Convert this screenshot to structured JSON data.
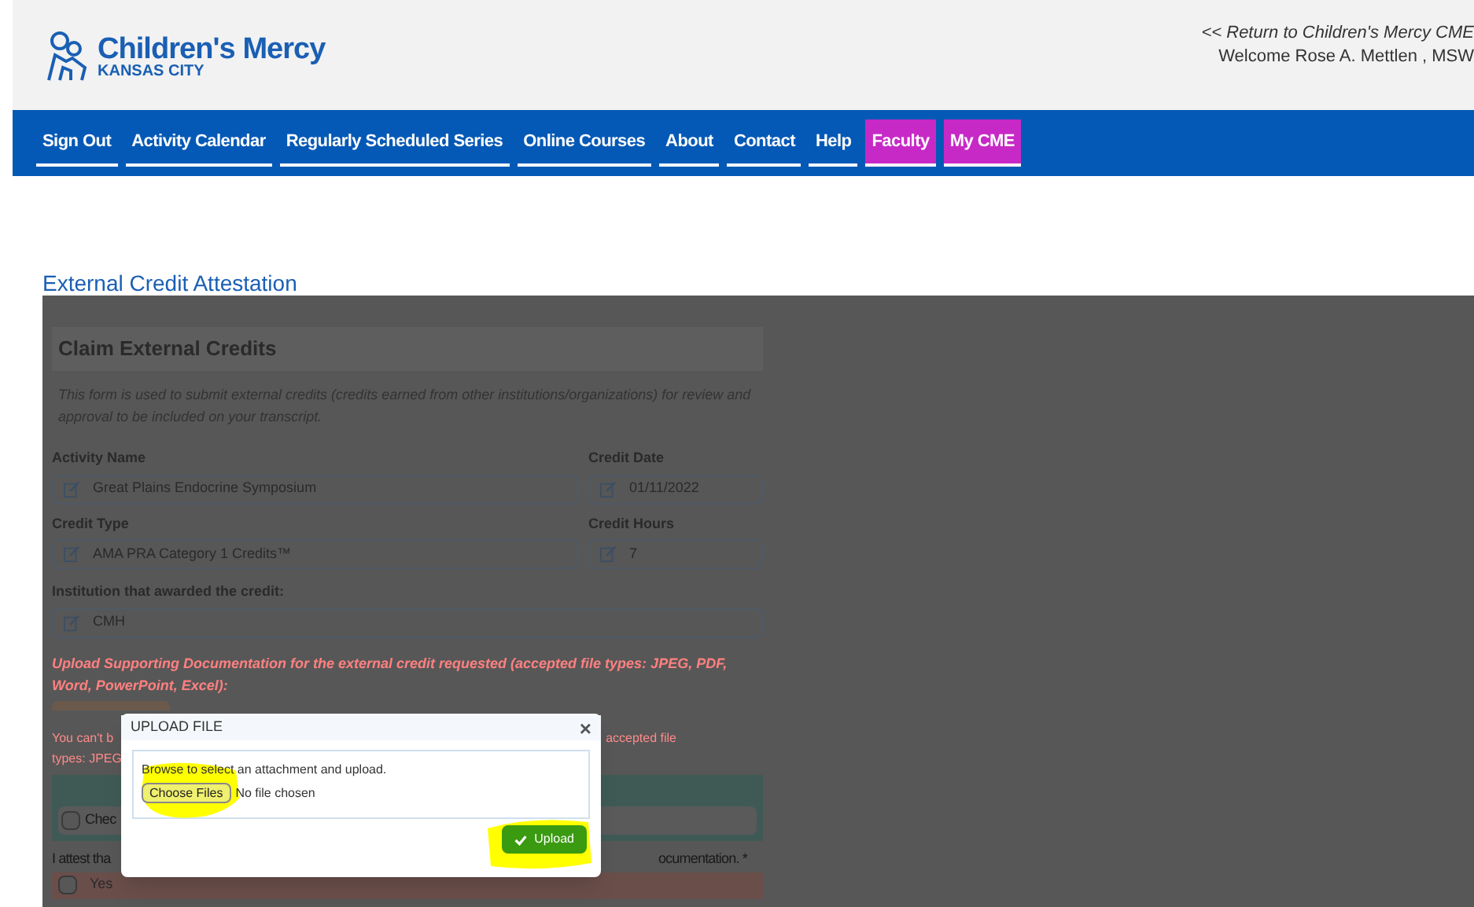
{
  "header": {
    "logo_name": "Children's Mercy",
    "logo_sub": "KANSAS CITY",
    "return_link": "<< Return to Children's Mercy CME",
    "welcome": "Welcome Rose A. Mettlen , MSW"
  },
  "nav": [
    {
      "label": "Sign Out",
      "highlighted": false
    },
    {
      "label": "Activity Calendar",
      "highlighted": false
    },
    {
      "label": "Regularly Scheduled Series",
      "highlighted": false
    },
    {
      "label": "Online Courses",
      "highlighted": false
    },
    {
      "label": "About",
      "highlighted": false
    },
    {
      "label": "Contact",
      "highlighted": false
    },
    {
      "label": "Help",
      "highlighted": false
    },
    {
      "label": "Faculty",
      "highlighted": true
    },
    {
      "label": "My CME",
      "highlighted": true
    }
  ],
  "page_title": "External Credit Attestation",
  "form": {
    "title": "Claim External Credits",
    "description": "This form is used to submit external credits (credits earned from other institutions/organizations) for review and approval to be included on your transcript.",
    "activity_name": {
      "label": "Activity Name",
      "value": "Great Plains Endocrine Symposium"
    },
    "credit_date": {
      "label": "Credit Date",
      "value": "01/11/2022"
    },
    "credit_type": {
      "label": "Credit Type",
      "value": "AMA PRA Category 1 Credits™"
    },
    "credit_hours": {
      "label": "Credit Hours",
      "value": "7"
    },
    "institution": {
      "label": "Institution that awarded the credit:",
      "value": "CMH"
    },
    "upload_note": "Upload Supporting Documentation for the external credit requested (accepted file types: JPEG, PDF, Word, PowerPoint, Excel):",
    "warning_left": [
      "You can't b",
      "types: JPEG"
    ],
    "warning_right": "accepted file",
    "check": {
      "label": "Chec",
      "checked": false
    },
    "attest_left": "I attest tha",
    "attest_right": "ocumentation. *",
    "yes": {
      "label": "Yes",
      "checked": false
    }
  },
  "modal": {
    "title": "UPLOAD FILE",
    "close": "×",
    "instruction": "Browse to select an attachment and upload.",
    "choose": "Choose Files",
    "no_file": "No file chosen",
    "upload": "Upload"
  }
}
